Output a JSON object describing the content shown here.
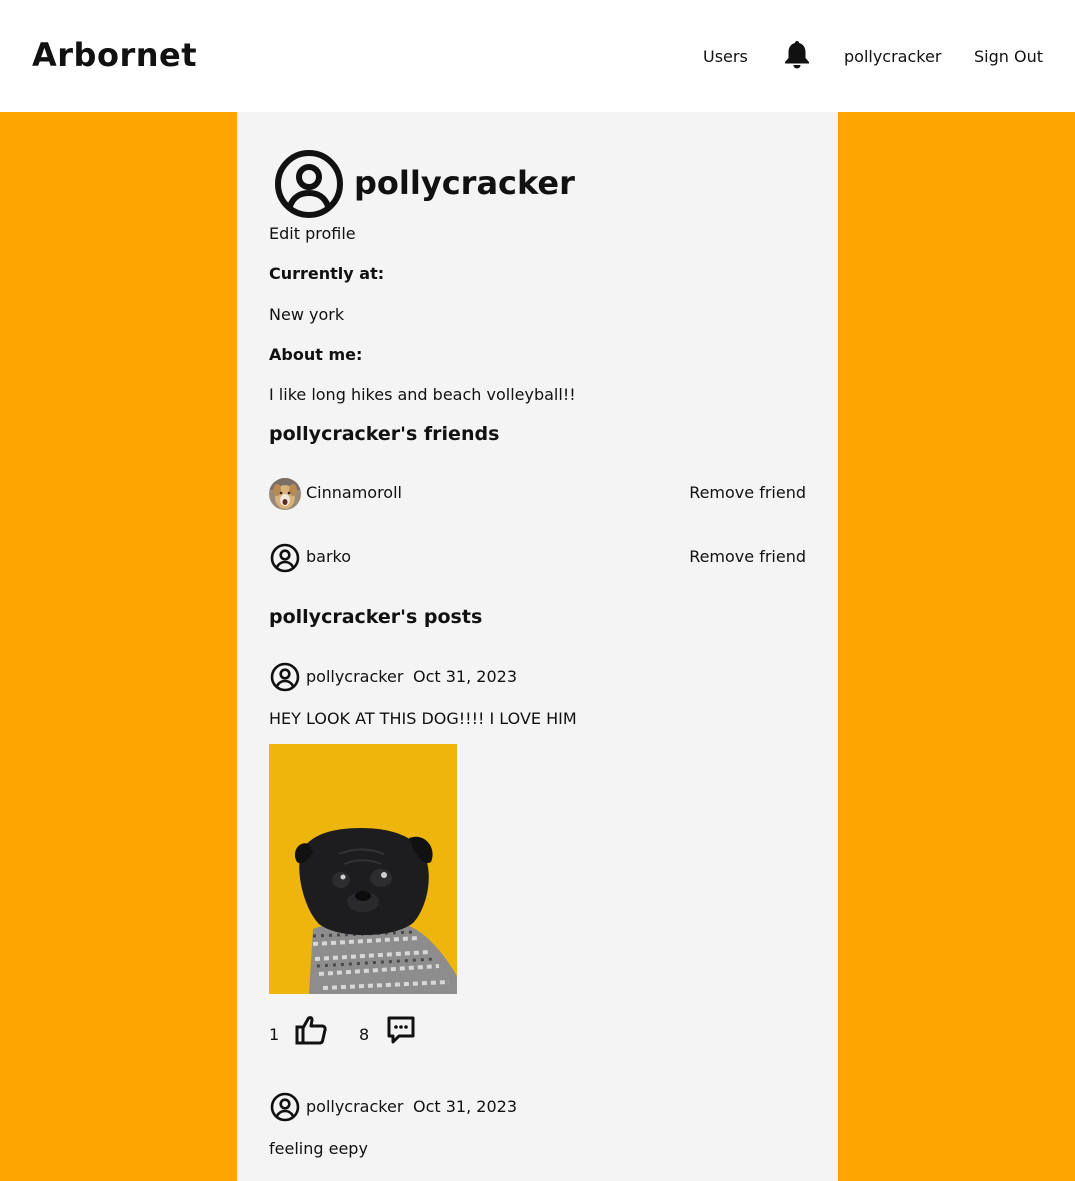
{
  "header": {
    "brand": "Arbornet",
    "nav": {
      "users": "Users",
      "bell_icon": "bell-icon",
      "username": "pollycracker",
      "sign_out": "Sign Out"
    }
  },
  "profile": {
    "username": "pollycracker",
    "edit_profile": "Edit profile",
    "currently_at_label": "Currently at:",
    "currently_at_value": "New york",
    "about_me_label": "About me:",
    "about_me_value": "I like long hikes and beach volleyball!!"
  },
  "friends": {
    "heading": "pollycracker's friends",
    "items": [
      {
        "name": "Cinnamoroll",
        "action": "Remove friend",
        "avatar": "photo-avatar"
      },
      {
        "name": "barko",
        "action": "Remove friend",
        "avatar": "user-circle-icon"
      }
    ]
  },
  "posts": {
    "heading": "pollycracker's posts",
    "items": [
      {
        "author": "pollycracker",
        "date": "Oct 31, 2023",
        "text": "HEY LOOK AT THIS DOG!!!! I LOVE HIM",
        "has_image": true,
        "likes": "1",
        "comments": "8"
      },
      {
        "author": "pollycracker",
        "date": "Oct 31, 2023",
        "text": "feeling eepy",
        "has_image": false
      }
    ]
  },
  "colors": {
    "background": "#ffa500",
    "panel": "#f4f4f4",
    "header": "#ffffff",
    "image_backdrop": "#eeb60c"
  }
}
